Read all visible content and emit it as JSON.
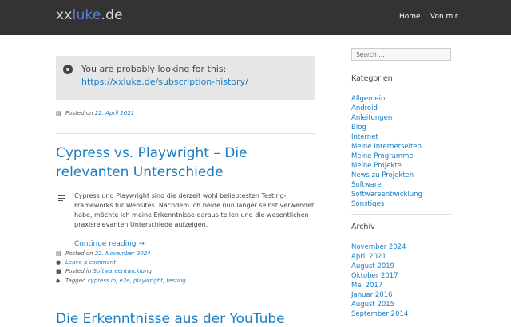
{
  "header": {
    "logo_part1": "xx",
    "logo_part2": "luke",
    "logo_part3": ".de",
    "nav": [
      "Home",
      "Von mir"
    ]
  },
  "notice": {
    "text": "You are probably looking for this:",
    "link": "https://xxluke.de/subscription-history/"
  },
  "first_post_meta": {
    "prefix": "Posted on",
    "date": "22. April 2021"
  },
  "post": {
    "title": "Cypress vs. Playwright – Die relevanten Unterschiede",
    "excerpt": "Cypress und Playwright sind die derzeit wohl beliebtesten Testing-Frameworks für Websites. Nachdem ich beide nun länger selbst verwendet habe, möchte ich meine Erkenntnisse daraus teilen und die wesentlichen praxisrelevanten Unterschiede aufzeigen.",
    "continue": "Continue reading →",
    "posted_prefix": "Posted on",
    "date": "22. November 2024",
    "comment": "Leave a comment",
    "category_prefix": "Posted in",
    "category": "Softwareentwicklung",
    "tags_prefix": "Tagged",
    "tags": "cypress.io, e2e, playwright, testing"
  },
  "next_post_title": "Die Erkenntnisse aus der YouTube",
  "sidebar": {
    "search_placeholder": "Search …",
    "categories_heading": "Kategorien",
    "categories": [
      "Allgemein",
      "Android",
      "Anleitungen",
      "Blog",
      "Internet",
      "Meine Internetseiten",
      "Meine Programme",
      "Meine Projekte",
      "News zu Projekten",
      "Software",
      "Softwareentwicklung",
      "Sonstiges"
    ],
    "archive_heading": "Archiv",
    "archive": [
      "November 2024",
      "April 2021",
      "August 2019",
      "Oktober 2017",
      "Mai 2017",
      "Januar 2016",
      "August 2015",
      "September 2014"
    ]
  }
}
